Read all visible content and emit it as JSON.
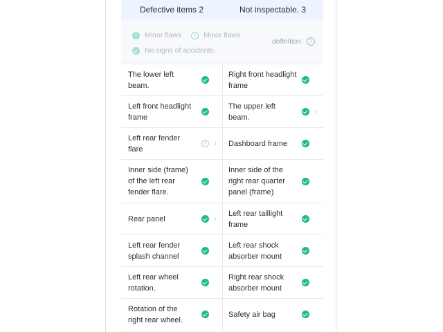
{
  "summary": {
    "defective": "Defective items 2",
    "not_inspectable": "Not inspectable. 3"
  },
  "legend": {
    "minor_flaws_1": "Minor flaws",
    "minor_flaws_2": "Minor flaws",
    "no_accidents": "No signs of accidents.",
    "definition": "definition",
    "colors": {
      "ok": "#21b88e",
      "faded": "#a6dfca"
    }
  },
  "items": [
    {
      "left": {
        "label": "The lower left beam.",
        "status": "ok",
        "icon": "check-circle-icon",
        "chevron": false
      },
      "right": {
        "label": "Right front headlight frame",
        "status": "ok",
        "icon": "check-circle-icon",
        "chevron": false
      }
    },
    {
      "left": {
        "label": "Left front headlight frame",
        "status": "ok",
        "icon": "check-circle-icon",
        "chevron": false
      },
      "right": {
        "label": "The upper left beam.",
        "status": "ok",
        "icon": "check-circle-icon",
        "chevron": true
      }
    },
    {
      "left": {
        "label": "Left rear fender flare",
        "status": "minor-flaw",
        "icon": "minor-flaw-icon",
        "chevron": true
      },
      "right": {
        "label": "Dashboard frame",
        "status": "ok",
        "icon": "check-circle-icon",
        "chevron": false
      }
    },
    {
      "left": {
        "label": "Inner side (frame) of the left rear fender flare.",
        "status": "ok",
        "icon": "check-circle-icon",
        "chevron": false
      },
      "right": {
        "label": "Inner side of the right rear quarter panel (frame)",
        "status": "ok",
        "icon": "check-circle-icon",
        "chevron": false
      }
    },
    {
      "left": {
        "label": "Rear panel",
        "status": "ok",
        "icon": "check-circle-icon",
        "chevron": true
      },
      "right": {
        "label": "Left rear taillight frame",
        "status": "ok",
        "icon": "check-circle-icon",
        "chevron": false
      }
    },
    {
      "left": {
        "label": "Left rear fender splash channel",
        "status": "ok",
        "icon": "check-circle-icon",
        "chevron": false
      },
      "right": {
        "label": "Left rear shock absorber mount",
        "status": "ok",
        "icon": "check-circle-icon",
        "chevron": false
      }
    },
    {
      "left": {
        "label": "Left rear wheel rotation.",
        "status": "ok",
        "icon": "check-circle-icon",
        "chevron": false
      },
      "right": {
        "label": "Right rear shock absorber mount",
        "status": "ok",
        "icon": "check-circle-icon",
        "chevron": false
      }
    },
    {
      "left": {
        "label": "Rotation of the right rear wheel.",
        "status": "ok",
        "icon": "check-circle-icon",
        "chevron": false
      },
      "right": {
        "label": "Safety air bag",
        "status": "ok",
        "icon": "check-circle-icon",
        "chevron": false
      }
    }
  ]
}
